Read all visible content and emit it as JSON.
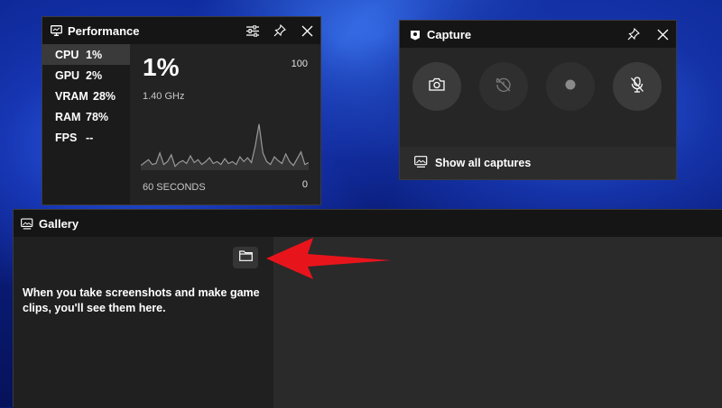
{
  "performance": {
    "title": "Performance",
    "metrics": [
      {
        "name": "CPU",
        "value": "1%"
      },
      {
        "name": "GPU",
        "value": "2%"
      },
      {
        "name": "VRAM",
        "value": "28%"
      },
      {
        "name": "RAM",
        "value": "78%"
      },
      {
        "name": "FPS",
        "value": "--"
      }
    ],
    "current_value": "1%",
    "frequency": "1.40 GHz",
    "graph_max": "100",
    "graph_min": "0",
    "time_window": "60 SECONDS",
    "history_percent": [
      5,
      8,
      11,
      6,
      7,
      18,
      6,
      9,
      16,
      4,
      8,
      10,
      7,
      15,
      8,
      11,
      6,
      9,
      13,
      7,
      9,
      6,
      12,
      7,
      9,
      6,
      14,
      9,
      13,
      8,
      25,
      48,
      18,
      9,
      6,
      14,
      10,
      7,
      17,
      9,
      5,
      12,
      19,
      6,
      8
    ]
  },
  "capture": {
    "title": "Capture",
    "buttons": [
      {
        "icon": "camera-icon",
        "state": "enabled"
      },
      {
        "icon": "record-last-icon",
        "state": "disabled"
      },
      {
        "icon": "record-icon",
        "state": "disabled"
      },
      {
        "icon": "mic-off-icon",
        "state": "enabled"
      }
    ],
    "show_all_label": "Show all captures"
  },
  "gallery": {
    "title": "Gallery",
    "empty_message": "When you take screenshots and make game clips, you'll see them here."
  },
  "colors": {
    "annotation_arrow": "#e8141c",
    "panel_bg": "#1e1e1e",
    "titlebar_bg": "#151515"
  }
}
